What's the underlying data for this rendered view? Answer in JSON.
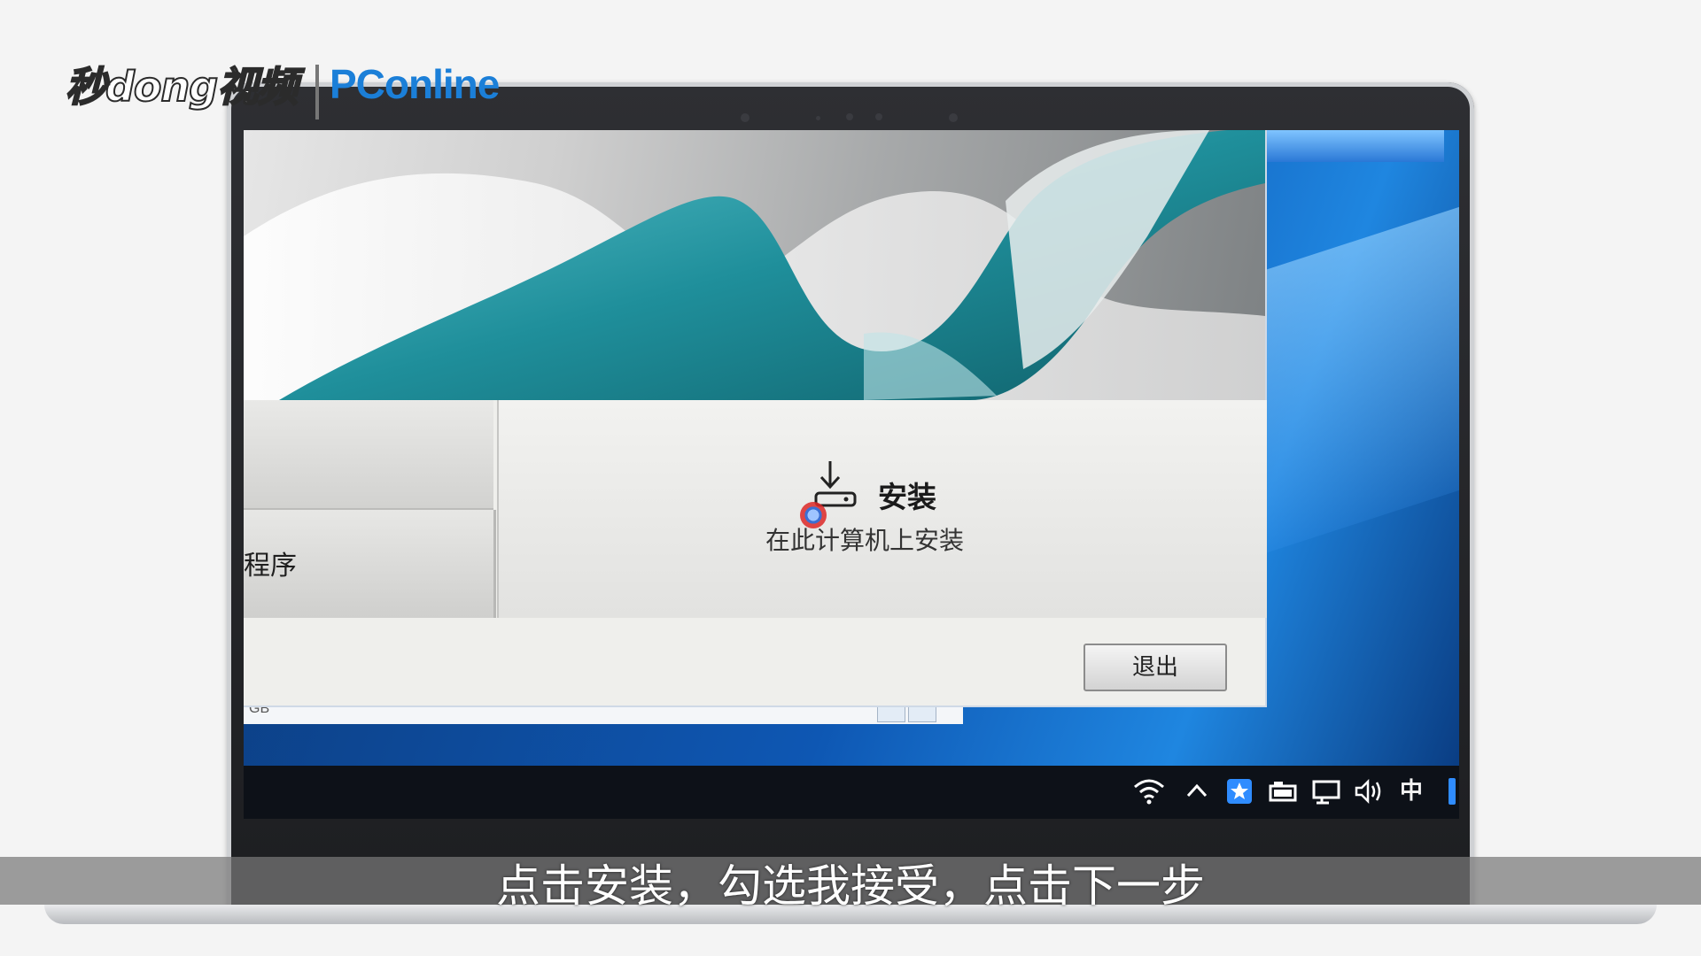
{
  "branding": {
    "video_logo": "秒dong视频",
    "site_logo": "PConline"
  },
  "installer": {
    "left_option_2_label": "程序",
    "install_title": "安装",
    "install_subtitle": "在此计算机上安装",
    "exit_label": "退出"
  },
  "background_window": {
    "field_text": "GB"
  },
  "tray": {
    "wifi": "wifi-icon",
    "chevron": "^",
    "ime": "中"
  },
  "subtitle": "点击安装，勾选我接受，点击下一步",
  "colors": {
    "accent_teal": "#2a9aa6",
    "desktop_blue": "#0e57b3",
    "brand_blue": "#1b7fd8"
  }
}
